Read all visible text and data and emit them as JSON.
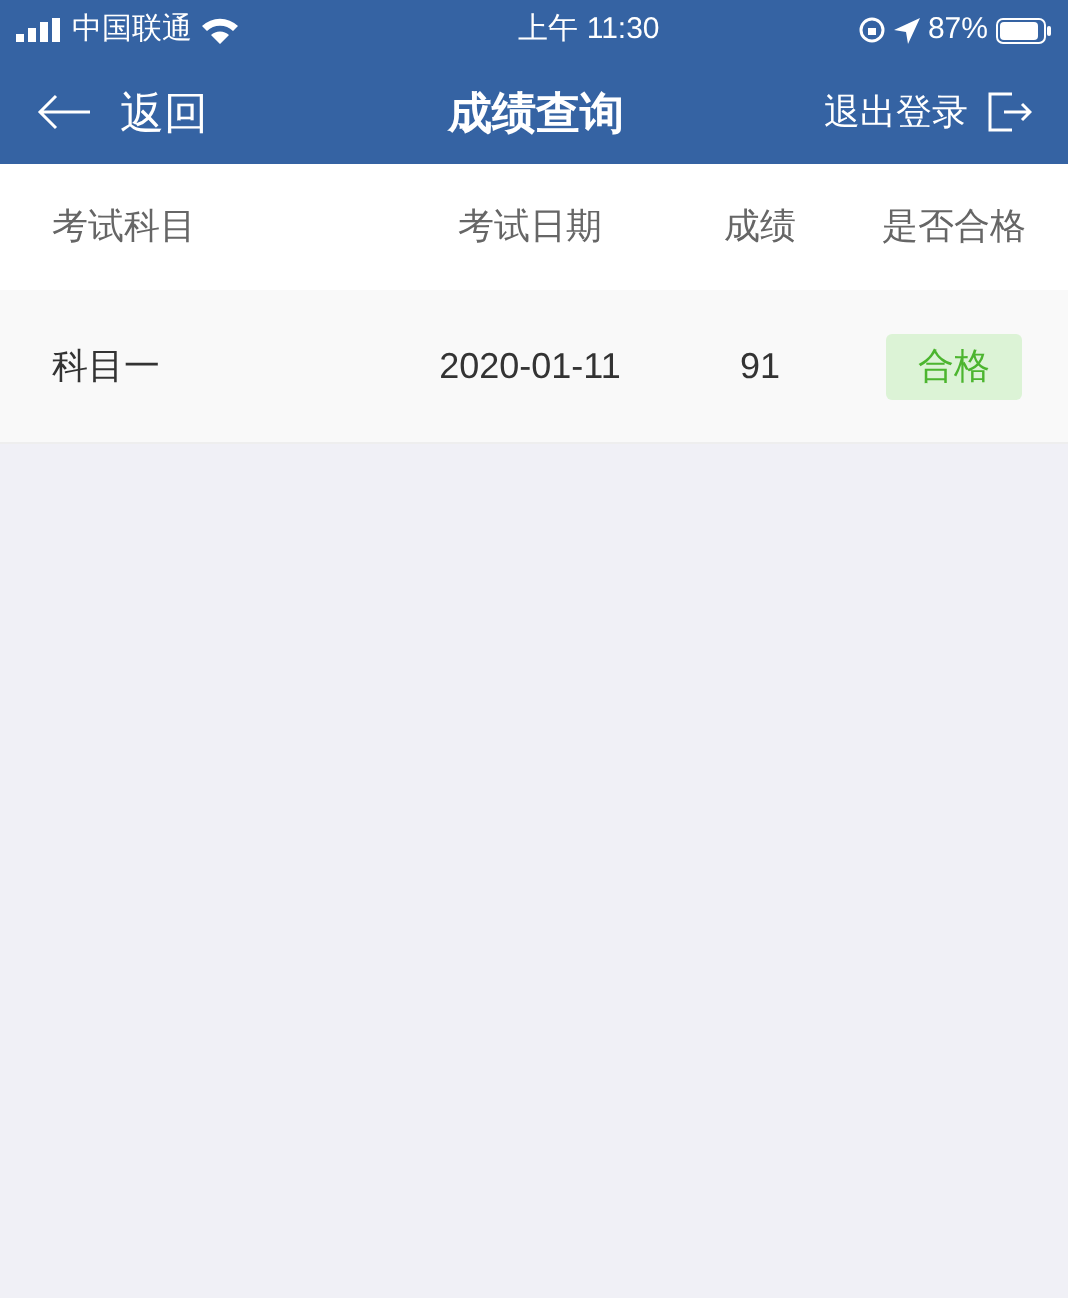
{
  "status_bar": {
    "carrier": "中国联通",
    "time": "上午 11:30",
    "battery": "87%"
  },
  "nav": {
    "back": "返回",
    "title": "成绩查询",
    "logout": "退出登录"
  },
  "table": {
    "columns": [
      "考试科目",
      "考试日期",
      "成绩",
      "是否合格"
    ],
    "rows": [
      {
        "subject": "科目一",
        "date": "2020-01-11",
        "score": "91",
        "result": "合格",
        "passed": true
      }
    ]
  }
}
